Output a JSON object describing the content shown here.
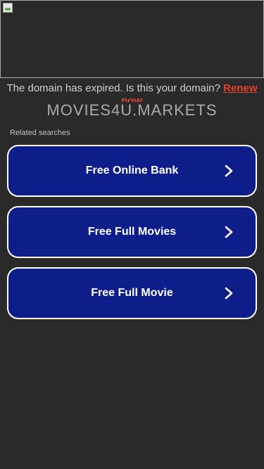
{
  "banner": {
    "icon": "broken-image-icon"
  },
  "notice": {
    "text": "The domain has expired. Is this your domain?",
    "renew_label": "Renew",
    "renew_now_label": "now"
  },
  "domain": {
    "title": "MOVIES4U.MARKETS"
  },
  "related": {
    "label": "Related searches",
    "items": [
      {
        "label": "Free Online Bank",
        "icon": "chevron-right-icon"
      },
      {
        "label": "Free Full Movies",
        "icon": "chevron-right-icon"
      },
      {
        "label": "Free Full Movie",
        "icon": "chevron-right-icon"
      }
    ]
  },
  "colors": {
    "background": "#2a2a2a",
    "button_fill": "#0d1e8a",
    "button_border": "#ffffff",
    "renew_link": "#e0422b"
  }
}
